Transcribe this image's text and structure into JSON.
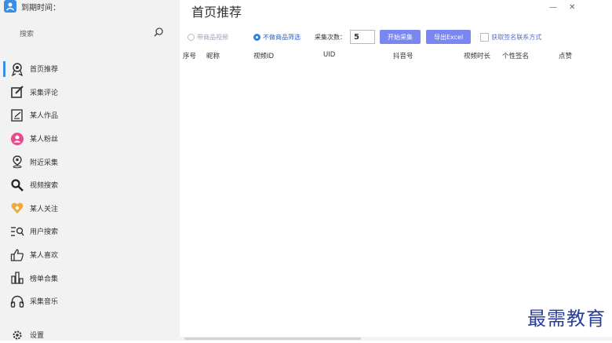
{
  "app": {
    "expire_label": "到期时间：",
    "search_placeholder": "搜索"
  },
  "sidebar": {
    "items": [
      {
        "label": "首页推荐",
        "icon": "award-icon"
      },
      {
        "label": "采集评论",
        "icon": "edit-icon"
      },
      {
        "label": "某人作品",
        "icon": "document-edit-icon"
      },
      {
        "label": "某人粉丝",
        "icon": "user-icon"
      },
      {
        "label": "附近采集",
        "icon": "location-icon"
      },
      {
        "label": "视频搜索",
        "icon": "search-icon"
      },
      {
        "label": "某人关注",
        "icon": "heart-icon"
      },
      {
        "label": "用户搜索",
        "icon": "list-search-icon"
      },
      {
        "label": "某人喜欢",
        "icon": "thumbs-up-icon"
      },
      {
        "label": "榜单合集",
        "icon": "bar-chart-icon"
      },
      {
        "label": "采集音乐",
        "icon": "headphones-icon"
      }
    ],
    "settings_label": "设置"
  },
  "main": {
    "title": "首页推荐",
    "radio_product_video": "带商品视频",
    "radio_no_filter": "不做商品筛选",
    "count_label": "采集次数：",
    "count_value": "5",
    "start_button": "开始采集",
    "export_button": "导出Excel",
    "signature_contact_label": "获取签名联系方式",
    "columns": [
      "序号",
      "昵称",
      "视频ID",
      "UID",
      "抖音号",
      "视频时长",
      "个性签名",
      "点赞"
    ]
  },
  "watermark": "最需教育",
  "colors": {
    "accent": "#7b87f0",
    "active_indicator": "#3a8ee6",
    "sidebar_bg": "#f2f2f2"
  }
}
